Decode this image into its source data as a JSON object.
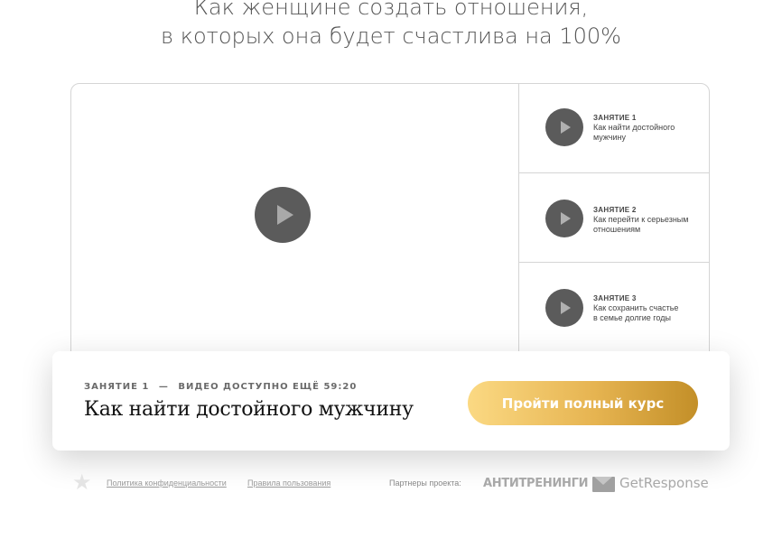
{
  "headline": {
    "line1": "Как женщине создать отношения,",
    "line2": "в которых она будет счастлива на 100%"
  },
  "lessons": [
    {
      "number": "ЗАНЯТИЕ 1",
      "title_line1": "Как найти достойного",
      "title_line2": "мужчину"
    },
    {
      "number": "ЗАНЯТИЕ 2",
      "title_line1": "Как перейти к серьезным",
      "title_line2": "отношениям"
    },
    {
      "number": "ЗАНЯТИЕ 3",
      "title_line1": "Как сохранить счастье",
      "title_line2": "в семье долгие годы"
    }
  ],
  "card": {
    "lesson_label": "ЗАНЯТИЕ 1",
    "dash": "—",
    "availability": "ВИДЕО ДОСТУПНО ЕЩЁ 59:20",
    "title": "Как найти достойного мужчину",
    "cta_label": "Пройти полный курс"
  },
  "footer": {
    "privacy_link": "Политика конфиденциальности",
    "terms_link": "Правила пользования",
    "partners_label": "Партнеры проекта:",
    "partner_1": "АНТИТРЕНИНГИ",
    "partner_2": "GetResponse"
  },
  "colors": {
    "cta_gradient_start": "#fbd983",
    "cta_gradient_end": "#c38f28",
    "play_button": "#5b5b5b"
  }
}
